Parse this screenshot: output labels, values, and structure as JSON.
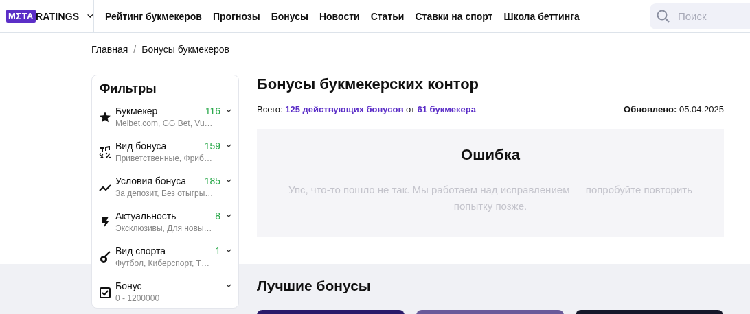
{
  "header": {
    "logo": {
      "mark": "MΣTA",
      "text": "RATINGS"
    },
    "nav": [
      "Рейтинг букмекеров",
      "Прогнозы",
      "Бонусы",
      "Новости",
      "Статьи",
      "Ставки на спорт",
      "Школа беттинга"
    ],
    "search": {
      "placeholder": "Поиск"
    }
  },
  "breadcrumbs": [
    "Главная",
    "/",
    "Бонусы букмекеров"
  ],
  "filters": {
    "title": "Фильтры",
    "items": [
      {
        "label": "Букмекер",
        "count": "116",
        "summary": "Melbet.com, GG Bet, Vu…"
      },
      {
        "label": "Вид бонуса",
        "count": "159",
        "summary": "Приветственные, Фриб…"
      },
      {
        "label": "Условия бонуса",
        "count": "185",
        "summary": "За депозит, Без отыгры…"
      },
      {
        "label": "Актуальность",
        "count": "8",
        "summary": "Эксклюзивы, Для новы…"
      },
      {
        "label": "Вид спорта",
        "count": "1",
        "summary": "Футбол, Киберспорт, Т…"
      },
      {
        "label": "Бонус",
        "summary": "0 - 1200000"
      }
    ]
  },
  "main": {
    "title": "Бонусы букмекерских контор",
    "summary": "Всего: **125 действующих бонусов** от **61 букмекера**",
    "updated": {
      "label": "Обновлено:",
      "value": "05.04.2025"
    },
    "error": {
      "title": "Ошибка",
      "message": "Упс, что-то пошло не так. Мы работаем над исправлением — попробуйте повторить попытку позже."
    }
  },
  "best": {
    "title": "Лучшие бонусы"
  }
}
